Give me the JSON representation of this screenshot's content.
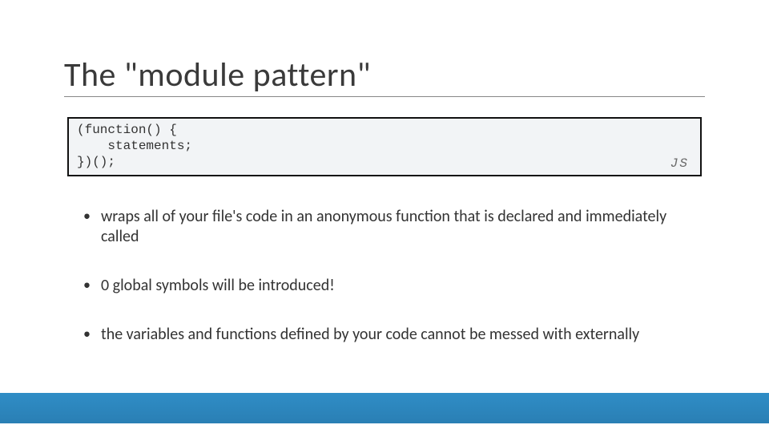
{
  "title": "The \"module pattern\"",
  "code": {
    "lines": [
      "(function() {",
      "    statements;",
      "})();"
    ],
    "lang_badge": "JS"
  },
  "bullets": [
    "wraps all of your file's code in an anonymous function that is declared and immediately called",
    "0 global symbols will be introduced!",
    "the variables and functions defined by your code cannot be messed with externally"
  ]
}
